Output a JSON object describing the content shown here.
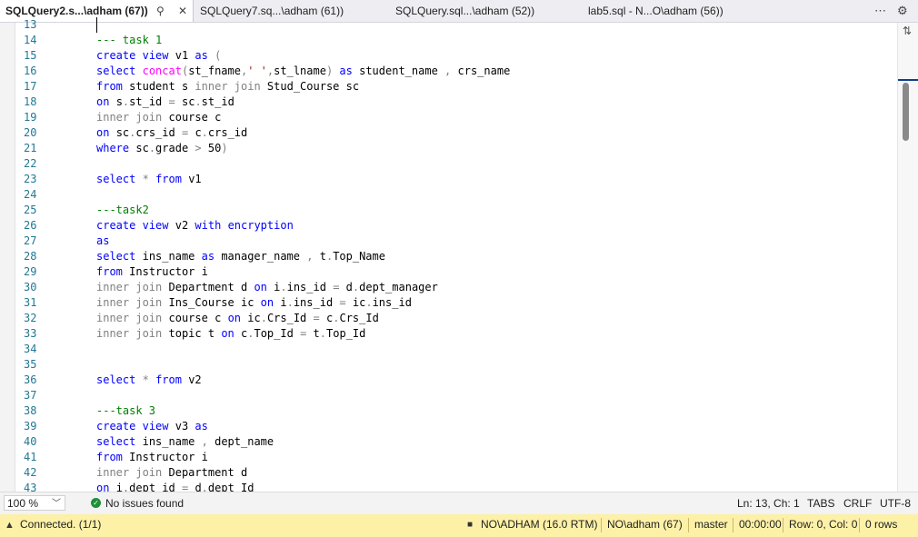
{
  "tabs": [
    {
      "label": "SQLQuery2.s...\\adham (67))",
      "active": true
    },
    {
      "label": "SQLQuery7.sq...\\adham (61))",
      "active": false
    },
    {
      "label": "SQLQuery.sql...\\adham (52))",
      "active": false
    },
    {
      "label": "lab5.sql - N...O\\adham (56))",
      "active": false
    }
  ],
  "tab_icons": {
    "pin": "pin-icon",
    "close": "close-icon",
    "overflow": "more-icon",
    "settings": "gear-icon"
  },
  "editor": {
    "line_numbers": [
      "13",
      "14",
      "15",
      "16",
      "17",
      "18",
      "19",
      "20",
      "21",
      "22",
      "23",
      "24",
      "25",
      "26",
      "27",
      "28",
      "29",
      "30",
      "31",
      "32",
      "33",
      "34",
      "35",
      "36",
      "37",
      "38",
      "39",
      "40",
      "41",
      "42",
      "43"
    ],
    "lines": [
      {
        "text": ""
      },
      {
        "text": "--- task 1"
      },
      {
        "text": "create view v1 as ("
      },
      {
        "text": "select concat(st_fname,' ',st_lname) as student_name , crs_name"
      },
      {
        "text": "from student s inner join Stud_Course sc"
      },
      {
        "text": "on s.st_id = sc.st_id"
      },
      {
        "text": "inner join course c"
      },
      {
        "text": "on sc.crs_id = c.crs_id"
      },
      {
        "text": "where sc.grade > 50)"
      },
      {
        "text": ""
      },
      {
        "text": "select * from v1"
      },
      {
        "text": ""
      },
      {
        "text": "---task2"
      },
      {
        "text": "create view v2 with encryption"
      },
      {
        "text": "as"
      },
      {
        "text": "select ins_name as manager_name , t.Top_Name"
      },
      {
        "text": "from Instructor i"
      },
      {
        "text": "inner join Department d on i.ins_id = d.dept_manager"
      },
      {
        "text": "inner join Ins_Course ic on i.ins_id = ic.ins_id"
      },
      {
        "text": "inner join course c on ic.Crs_Id = c.Crs_Id"
      },
      {
        "text": "inner join topic t on c.Top_Id = t.Top_Id"
      },
      {
        "text": ""
      },
      {
        "text": ""
      },
      {
        "text": "select * from v2"
      },
      {
        "text": ""
      },
      {
        "text": "---task 3"
      },
      {
        "text": "create view v3 as"
      },
      {
        "text": "select ins_name , dept_name"
      },
      {
        "text": "from Instructor i"
      },
      {
        "text": "inner join Department d"
      },
      {
        "text": "on i.dept_id = d.dept_Id"
      }
    ]
  },
  "status": {
    "zoom": "100 %",
    "issues": "No issues found",
    "position": "Ln: 13, Ch: 1",
    "tabs": "TABS",
    "line_endings": "CRLF",
    "encoding": "UTF-8"
  },
  "connection_bar": {
    "connected": "Connected. (1/1)",
    "server": "NO\\ADHAM (16.0 RTM)",
    "user": "NO\\adham (67)",
    "database": "master",
    "elapsed": "00:00:00",
    "row_col": "Row: 0, Col: 0",
    "rows": "0 rows"
  },
  "colors": {
    "keyword": "#0000ff",
    "comment": "#008000",
    "function": "#ff00ff",
    "string": "#a31515",
    "operator": "#808080",
    "line_number": "#237893",
    "connection_bar_bg": "#fdf1a8"
  }
}
